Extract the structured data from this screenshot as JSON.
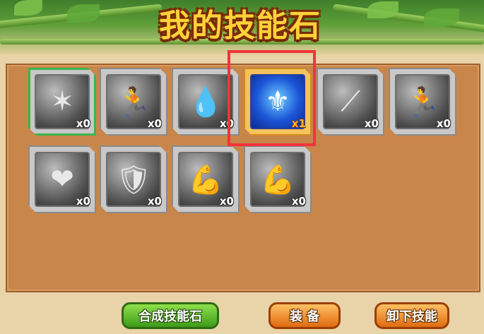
{
  "header": {
    "title": "我的技能石"
  },
  "slots": [
    {
      "icon": "light-beam-icon",
      "glyph": "✶",
      "count": "x0"
    },
    {
      "icon": "dash-runner-icon",
      "glyph": "🏃",
      "count": "x0"
    },
    {
      "icon": "water-drop-icon",
      "glyph": "💧",
      "count": "x0"
    },
    {
      "icon": "shield-icon",
      "glyph": "⚜",
      "count": "x1"
    },
    {
      "icon": "slash-icon",
      "glyph": "⟋",
      "count": "x0"
    },
    {
      "icon": "runner-icon",
      "glyph": "🏃",
      "count": "x0"
    },
    {
      "icon": "heart-orb-icon",
      "glyph": "❤",
      "count": "x0"
    },
    {
      "icon": "sword-shield-icon",
      "glyph": "🛡",
      "count": "x0"
    },
    {
      "icon": "muscle-whirl-icon",
      "glyph": "💪",
      "count": "x0"
    },
    {
      "icon": "muscle-guard-icon",
      "glyph": "💪",
      "count": "x0"
    }
  ],
  "buttons": {
    "combine": "合成技能石",
    "equip": "装 备",
    "unequip": "卸下技能"
  }
}
